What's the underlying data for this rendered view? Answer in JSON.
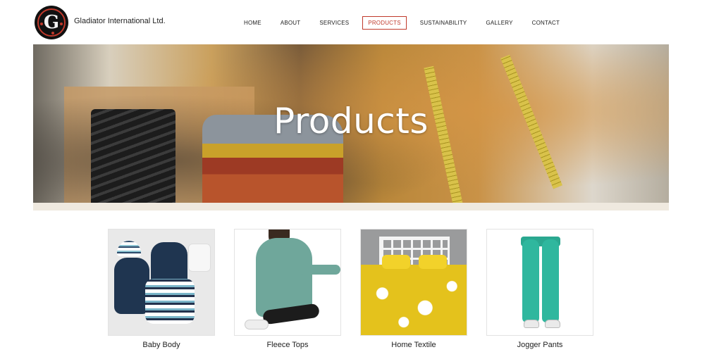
{
  "header": {
    "brand_name": "Gladiator International Ltd.",
    "logo_letter": "G"
  },
  "nav": {
    "items": [
      {
        "label": "HOME",
        "active": false
      },
      {
        "label": "ABOUT",
        "active": false
      },
      {
        "label": "SERVICES",
        "active": false
      },
      {
        "label": "PRODUCTS",
        "active": true
      },
      {
        "label": "SUSTAINABILITY",
        "active": false
      },
      {
        "label": "GALLERY",
        "active": false
      },
      {
        "label": "CONTACT",
        "active": false
      }
    ],
    "active_color": "#c0392b"
  },
  "hero": {
    "title": "Products"
  },
  "products": [
    {
      "label": "Baby Body"
    },
    {
      "label": "Fleece Tops"
    },
    {
      "label": "Home Textile"
    },
    {
      "label": "Jogger Pants"
    }
  ]
}
